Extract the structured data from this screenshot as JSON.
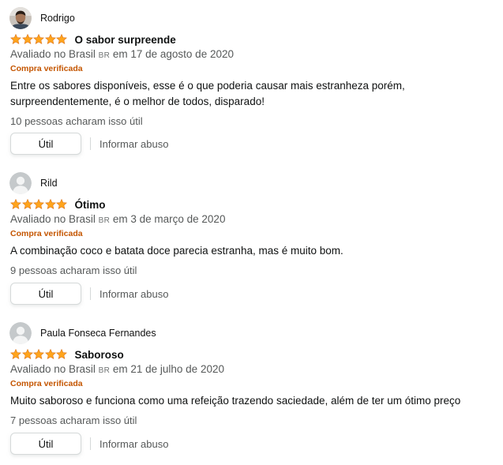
{
  "colors": {
    "star": "#ffa41c",
    "verified": "#c45500",
    "meta": "#565959"
  },
  "reviews": [
    {
      "author": "Rodrigo",
      "avatar": "photo",
      "rating": 5,
      "title": "O sabor surpreende",
      "meta_prefix": "Avaliado no Brasil",
      "flag": "BR",
      "meta_suffix": "em 17 de agosto de 2020",
      "verified": "Compra verificada",
      "body": "Entre os sabores disponíveis, esse é o que poderia causar mais estranheza porém, surpreendentemente, é o melhor de todos, disparado!",
      "helpful": "10 pessoas acharam isso útil",
      "useful_label": "Útil",
      "report_label": "Informar abuso"
    },
    {
      "author": "Rild",
      "avatar": "default-user-icon",
      "rating": 5,
      "title": "Ótimo",
      "meta_prefix": "Avaliado no Brasil",
      "flag": "BR",
      "meta_suffix": "em 3 de março de 2020",
      "verified": "Compra verificada",
      "body": "A combinação coco e batata doce parecia estranha, mas é muito bom.",
      "helpful": "9 pessoas acharam isso útil",
      "useful_label": "Útil",
      "report_label": "Informar abuso"
    },
    {
      "author": "Paula Fonseca Fernandes",
      "avatar": "default-user-icon",
      "rating": 5,
      "title": "Saboroso",
      "meta_prefix": "Avaliado no Brasil",
      "flag": "BR",
      "meta_suffix": "em 21 de julho de 2020",
      "verified": "Compra verificada",
      "body": "Muito saboroso e funciona como uma refeição trazendo saciedade, além de ter um ótimo preço",
      "helpful": "7 pessoas acharam isso útil",
      "useful_label": "Útil",
      "report_label": "Informar abuso"
    }
  ]
}
